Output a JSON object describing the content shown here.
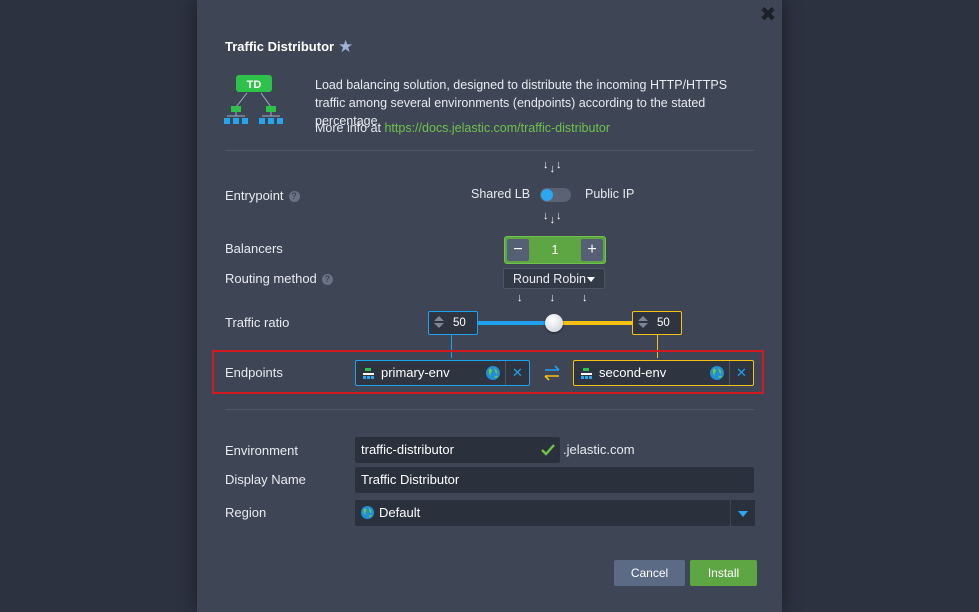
{
  "dialog": {
    "title": "Traffic Distributor",
    "close_label": "✖",
    "logo_text": "TD",
    "description": "Load balancing solution, designed to distribute the incoming HTTP/HTTPS traffic among several environments (endpoints) according to the stated percentage",
    "more_info_prefix": "More info at ",
    "more_info_link": "https://docs.jelastic.com/traffic-distributor"
  },
  "form": {
    "entrypoint": {
      "label": "Entrypoint",
      "help": "?",
      "option_left": "Shared LB",
      "option_right": "Public IP",
      "toggle_on": false
    },
    "balancers": {
      "label": "Balancers",
      "minus": "−",
      "value": "1",
      "plus": "+"
    },
    "routing_method": {
      "label": "Routing method",
      "help": "?",
      "value": "Round Robin"
    },
    "traffic_ratio": {
      "label": "Traffic ratio",
      "left_value": "50",
      "right_value": "50",
      "slider_fraction": 0.5
    },
    "endpoints": {
      "label": "Endpoints",
      "primary": "primary-env",
      "secondary": "second-env",
      "remove": "✕"
    },
    "environment": {
      "label": "Environment",
      "value": "traffic-distributor",
      "suffix": ".jelastic.com"
    },
    "display_name": {
      "label": "Display Name",
      "value": "Traffic Distributor"
    },
    "region": {
      "label": "Region",
      "value": "Default"
    }
  },
  "buttons": {
    "cancel": "Cancel",
    "install": "Install"
  },
  "colors": {
    "accent_blue": "#1ea2ef",
    "accent_yellow": "#f5c211",
    "accent_green": "#5ea543",
    "highlight_red": "#d01920"
  },
  "icons": {
    "close": "close-icon",
    "favorite": "star-icon",
    "help": "help-icon",
    "env": "server-icon",
    "globe": "globe-icon",
    "swap": "swap-icon",
    "valid": "checkmark-icon",
    "dropdown": "chevron-down-icon"
  }
}
